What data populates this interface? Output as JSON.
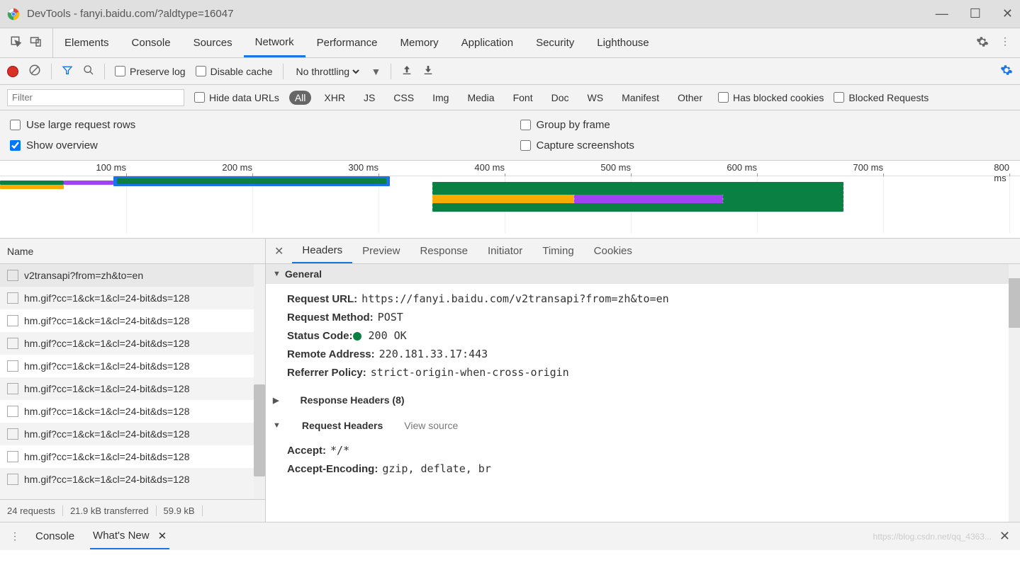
{
  "window": {
    "title": "DevTools - fanyi.baidu.com/?aldtype=16047"
  },
  "tabs": [
    "Elements",
    "Console",
    "Sources",
    "Network",
    "Performance",
    "Memory",
    "Application",
    "Security",
    "Lighthouse"
  ],
  "active_tab": "Network",
  "toolbar": {
    "preserve_log": "Preserve log",
    "disable_cache": "Disable cache",
    "throttling": "No throttling"
  },
  "filter": {
    "placeholder": "Filter",
    "hide_data_urls": "Hide data URLs",
    "types": [
      "All",
      "XHR",
      "JS",
      "CSS",
      "Img",
      "Media",
      "Font",
      "Doc",
      "WS",
      "Manifest",
      "Other"
    ],
    "active_type": "All",
    "has_blocked_cookies": "Has blocked cookies",
    "blocked_requests": "Blocked Requests"
  },
  "options": {
    "use_large_rows": "Use large request rows",
    "show_overview": "Show overview",
    "group_by_frame": "Group by frame",
    "capture_screenshots": "Capture screenshots"
  },
  "timeline_ticks": [
    "100 ms",
    "200 ms",
    "300 ms",
    "400 ms",
    "500 ms",
    "600 ms",
    "700 ms",
    "800 ms"
  ],
  "request_list": {
    "header": "Name",
    "items": [
      "v2transapi?from=zh&to=en",
      "hm.gif?cc=1&ck=1&cl=24-bit&ds=128",
      "hm.gif?cc=1&ck=1&cl=24-bit&ds=128",
      "hm.gif?cc=1&ck=1&cl=24-bit&ds=128",
      "hm.gif?cc=1&ck=1&cl=24-bit&ds=128",
      "hm.gif?cc=1&ck=1&cl=24-bit&ds=128",
      "hm.gif?cc=1&ck=1&cl=24-bit&ds=128",
      "hm.gif?cc=1&ck=1&cl=24-bit&ds=128",
      "hm.gif?cc=1&ck=1&cl=24-bit&ds=128",
      "hm.gif?cc=1&ck=1&cl=24-bit&ds=128"
    ],
    "footer": {
      "requests": "24 requests",
      "transferred": "21.9 kB transferred",
      "resources": "59.9 kB"
    }
  },
  "details_tabs": [
    "Headers",
    "Preview",
    "Response",
    "Initiator",
    "Timing",
    "Cookies"
  ],
  "details_active": "Headers",
  "details": {
    "general_title": "General",
    "general": {
      "request_url_k": "Request URL:",
      "request_url_v": "https://fanyi.baidu.com/v2transapi?from=zh&to=en",
      "request_method_k": "Request Method:",
      "request_method_v": "POST",
      "status_code_k": "Status Code:",
      "status_code_v": "200 OK",
      "remote_address_k": "Remote Address:",
      "remote_address_v": "220.181.33.17:443",
      "referrer_policy_k": "Referrer Policy:",
      "referrer_policy_v": "strict-origin-when-cross-origin"
    },
    "response_headers_title": "Response Headers (8)",
    "request_headers_title": "Request Headers",
    "view_source": "View source",
    "request_headers": {
      "accept_k": "Accept:",
      "accept_v": "*/*",
      "accept_encoding_k": "Accept-Encoding:",
      "accept_encoding_v": "gzip, deflate, br"
    }
  },
  "drawer": {
    "console": "Console",
    "whats_new": "What's New"
  },
  "watermark": "https://blog.csdn.net/qq_4363..."
}
